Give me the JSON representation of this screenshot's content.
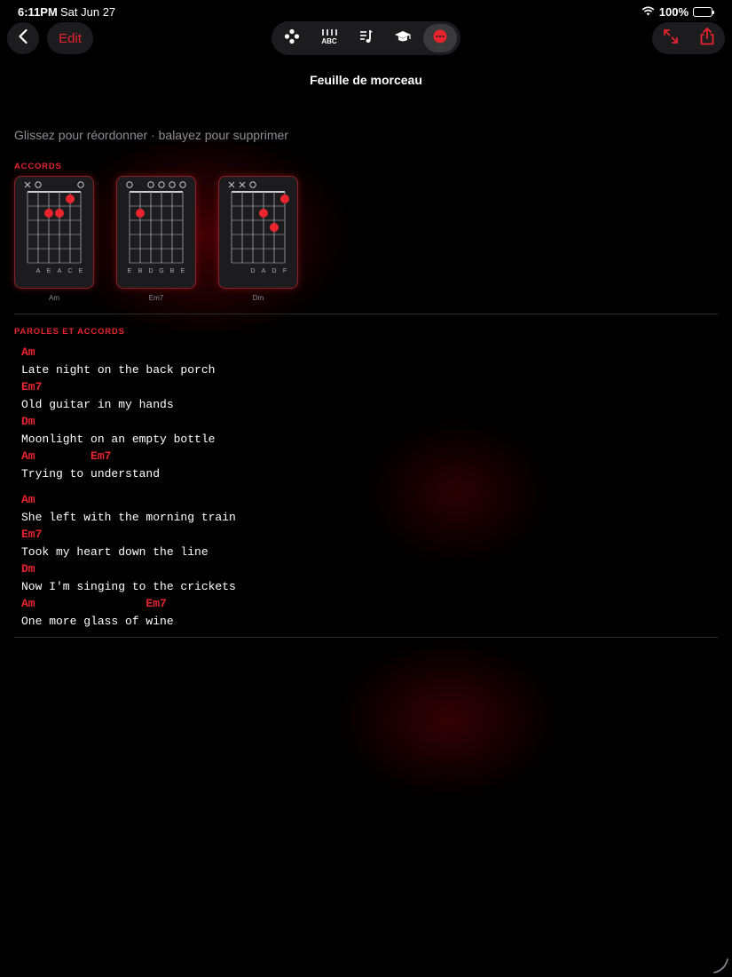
{
  "status": {
    "time": "6:11PM",
    "date": "Sat Jun 27",
    "battery": "100%"
  },
  "nav": {
    "edit_label": "Edit"
  },
  "toolbar": {
    "items": [
      {
        "icon": "dice-icon"
      },
      {
        "icon": "tab-notation-icon",
        "label": "ABC"
      },
      {
        "icon": "music-notes-icon"
      },
      {
        "icon": "graduation-cap-icon"
      },
      {
        "icon": "more-icon",
        "active": true
      }
    ]
  },
  "page": {
    "title": "Feuille de morceau",
    "hint": "Glissez pour réordonner · balayez pour supprimer"
  },
  "chords_section": {
    "label": "ACCORDS",
    "chords": [
      {
        "name": "Am",
        "markers": [
          "x",
          "o",
          "",
          "",
          "",
          "o"
        ],
        "strings": [
          "",
          "A",
          "E",
          "A",
          "C",
          "E"
        ],
        "dots": [
          [
            3,
            2
          ],
          [
            2,
            2
          ],
          [
            4,
            1
          ]
        ]
      },
      {
        "name": "Em7",
        "markers": [
          "o",
          "",
          "o",
          "o",
          "o",
          "o"
        ],
        "strings": [
          "E",
          "B",
          "D",
          "G",
          "B",
          "E"
        ],
        "dots": [
          [
            1,
            2
          ]
        ]
      },
      {
        "name": "Dm",
        "markers": [
          "x",
          "x",
          "o",
          "",
          "",
          ""
        ],
        "strings": [
          "",
          "",
          "D",
          "A",
          "D",
          "F"
        ],
        "dots": [
          [
            3,
            2
          ],
          [
            4,
            3
          ],
          [
            5,
            1
          ]
        ]
      }
    ]
  },
  "lyrics_section": {
    "label": "PAROLES ET ACCORDS",
    "stanzas": [
      [
        {
          "chords": "Am",
          "text": "Late night on the back porch"
        },
        {
          "chords": "Em7",
          "text": "Old guitar in my hands"
        },
        {
          "chords": "Dm",
          "text": "Moonlight on an empty bottle"
        },
        {
          "chords": "Am        Em7",
          "text": "Trying to understand"
        }
      ],
      [
        {
          "chords": "Am",
          "text": "She left with the morning train"
        },
        {
          "chords": "Em7",
          "text": "Took my heart down the line"
        },
        {
          "chords": "Dm",
          "text": "Now I'm singing to the crickets"
        },
        {
          "chords": "Am                Em7",
          "text": "One more glass of wine"
        }
      ]
    ]
  },
  "colors": {
    "accent": "#e8242e",
    "background": "#000000",
    "card": "#1c1c1e",
    "muted": "#8e8e93"
  }
}
